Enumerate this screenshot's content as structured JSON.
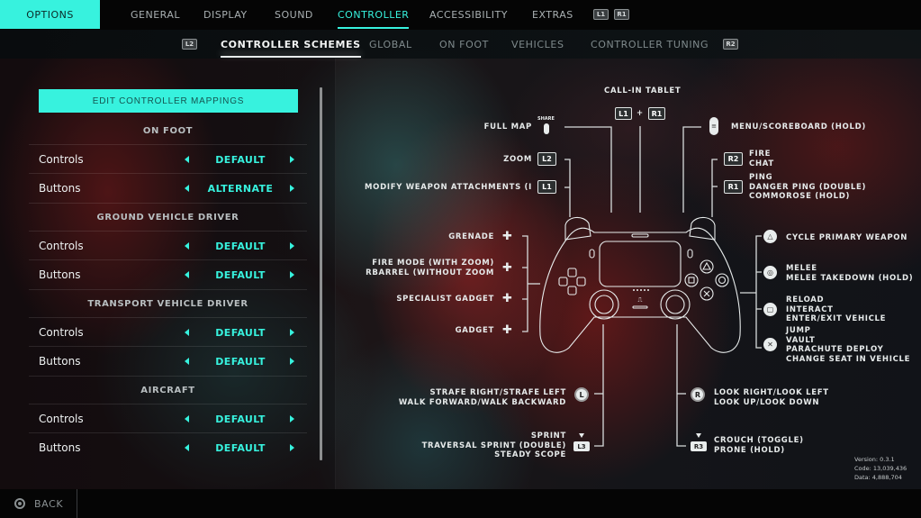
{
  "topnav": {
    "options_label": "OPTIONS",
    "tabs": [
      {
        "label": "GENERAL",
        "active": false
      },
      {
        "label": "DISPLAY",
        "active": false
      },
      {
        "label": "SOUND",
        "active": false
      },
      {
        "label": "CONTROLLER",
        "active": true
      },
      {
        "label": "ACCESSIBILITY",
        "active": false
      },
      {
        "label": "EXTRAS",
        "active": false
      }
    ],
    "prev_hint": "L1",
    "next_hint": "R1"
  },
  "subnav": {
    "prev_hint": "L2",
    "next_hint": "R2",
    "tabs": [
      {
        "label": "CONTROLLER SCHEMES",
        "active": true
      },
      {
        "label": "GLOBAL",
        "active": false
      },
      {
        "label": "ON FOOT",
        "active": false
      },
      {
        "label": "VEHICLES",
        "active": false
      },
      {
        "label": "CONTROLLER TUNING",
        "active": false
      }
    ]
  },
  "left_panel": {
    "edit_button": "EDIT CONTROLLER MAPPINGS",
    "sections": [
      {
        "title": "ON FOOT",
        "rows": [
          {
            "label": "Controls",
            "value": "DEFAULT"
          },
          {
            "label": "Buttons",
            "value": "ALTERNATE"
          }
        ]
      },
      {
        "title": "GROUND VEHICLE DRIVER",
        "rows": [
          {
            "label": "Controls",
            "value": "DEFAULT"
          },
          {
            "label": "Buttons",
            "value": "DEFAULT"
          }
        ]
      },
      {
        "title": "TRANSPORT VEHICLE DRIVER",
        "rows": [
          {
            "label": "Controls",
            "value": "DEFAULT"
          },
          {
            "label": "Buttons",
            "value": "DEFAULT"
          }
        ]
      },
      {
        "title": "AIRCRAFT",
        "rows": [
          {
            "label": "Controls",
            "value": "DEFAULT"
          },
          {
            "label": "Buttons",
            "value": "DEFAULT"
          }
        ]
      }
    ]
  },
  "diagram": {
    "call_in": {
      "label": "CALL-IN TABLET",
      "btn1": "L1",
      "plus": "+",
      "btn2": "R1"
    },
    "full_map": {
      "label": "FULL MAP",
      "icon_text": "SHARE"
    },
    "zoom": {
      "label": "ZOOM",
      "btn": "L2"
    },
    "modify": {
      "label": "MODIFY WEAPON ATTACHMENTS (I",
      "btn": "L1"
    },
    "menu": {
      "label": "MENU/SCOREBOARD (HOLD)"
    },
    "r2": {
      "btn": "R2",
      "lines": [
        "FIRE",
        "CHAT"
      ]
    },
    "r1": {
      "btn": "R1",
      "lines": [
        "PING",
        "DANGER PING (DOUBLE)",
        "COMMOROSE (HOLD)"
      ]
    },
    "grenade": {
      "label": "GRENADE"
    },
    "fire_mode": {
      "lines": [
        "FIRE MODE (WITH ZOOM)",
        "RBARREL (WITHOUT ZOOM"
      ]
    },
    "specialist": {
      "label": "SPECIALIST GADGET"
    },
    "gadget": {
      "label": "GADGET"
    },
    "triangle": {
      "lines": [
        "CYCLE PRIMARY WEAPON"
      ]
    },
    "circle": {
      "lines": [
        "MELEE",
        "MELEE TAKEDOWN (HOLD)"
      ]
    },
    "square": {
      "lines": [
        "RELOAD",
        "INTERACT",
        "ENTER/EXIT VEHICLE"
      ]
    },
    "cross": {
      "lines": [
        "JUMP",
        "VAULT",
        "PARACHUTE DEPLOY",
        "CHANGE SEAT IN VEHICLE"
      ]
    },
    "left_stick": {
      "icon_text": "L",
      "lines": [
        "STRAFE RIGHT/STRAFE LEFT",
        "WALK FORWARD/WALK BACKWARD"
      ]
    },
    "l3": {
      "icon_text": "L3",
      "lines": [
        "SPRINT",
        "TRAVERSAL SPRINT (DOUBLE)",
        "STEADY SCOPE"
      ]
    },
    "right_stick": {
      "icon_text": "R",
      "lines": [
        "LOOK RIGHT/LOOK LEFT",
        "LOOK UP/LOOK DOWN"
      ]
    },
    "r3": {
      "icon_text": "R3",
      "lines": [
        "CROUCH (TOGGLE)",
        "PRONE (HOLD)"
      ]
    }
  },
  "version_info": {
    "version": "Version: 0.3.1",
    "code": "Code: 13,039,436",
    "data": "Data: 4,888,704"
  },
  "footer": {
    "back_label": "BACK"
  },
  "colors": {
    "accent": "#37f2de",
    "text": "#e6eaea",
    "muted": "#7f8a8c"
  }
}
